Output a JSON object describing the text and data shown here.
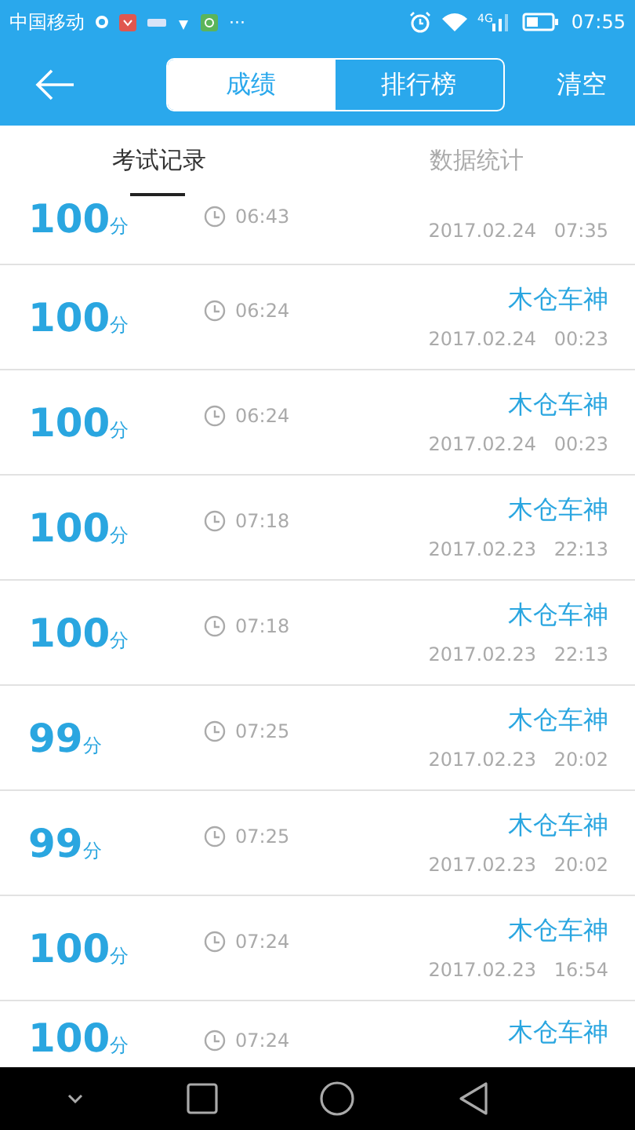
{
  "status_bar": {
    "carrier": "中国移动",
    "more": "···",
    "network": "4G",
    "time": "07:55"
  },
  "header": {
    "segments": [
      {
        "label": "成绩",
        "selected": true
      },
      {
        "label": "排行榜",
        "selected": false
      }
    ],
    "action": "清空"
  },
  "tabs": [
    {
      "label": "考试记录",
      "selected": true
    },
    {
      "label": "数据统计",
      "selected": false
    }
  ],
  "records": [
    {
      "score": "100",
      "unit": "分",
      "duration": "06:43",
      "date": "2017.02.24   07:35"
    },
    {
      "score": "100",
      "unit": "分",
      "duration": "06:24",
      "name": "木仓车神",
      "date": "2017.02.24   00:23"
    },
    {
      "score": "100",
      "unit": "分",
      "duration": "06:24",
      "name": "木仓车神",
      "date": "2017.02.24   00:23"
    },
    {
      "score": "100",
      "unit": "分",
      "duration": "07:18",
      "name": "木仓车神",
      "date": "2017.02.23   22:13"
    },
    {
      "score": "100",
      "unit": "分",
      "duration": "07:18",
      "name": "木仓车神",
      "date": "2017.02.23   22:13"
    },
    {
      "score": "99",
      "unit": "分",
      "duration": "07:25",
      "name": "木仓车神",
      "date": "2017.02.23   20:02"
    },
    {
      "score": "99",
      "unit": "分",
      "duration": "07:25",
      "name": "木仓车神",
      "date": "2017.02.23   20:02"
    },
    {
      "score": "100",
      "unit": "分",
      "duration": "07:24",
      "name": "木仓车神",
      "date": "2017.02.23   16:54"
    },
    {
      "score": "100",
      "unit": "分",
      "duration": "07:24",
      "name": "木仓车神"
    }
  ]
}
